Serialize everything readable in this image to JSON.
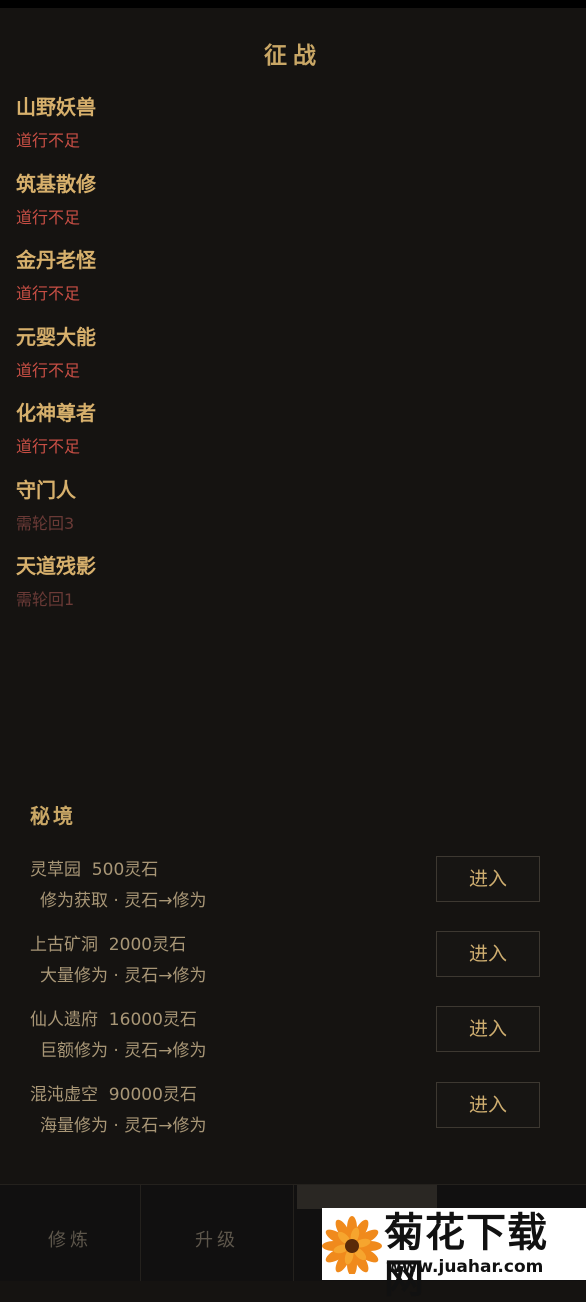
{
  "header": {
    "title": "征战"
  },
  "enemies": [
    {
      "name": "山野妖兽",
      "status": "道行不足"
    },
    {
      "name": "筑基散修",
      "status": "道行不足"
    },
    {
      "name": "金丹老怪",
      "status": "道行不足"
    },
    {
      "name": "元婴大能",
      "status": "道行不足"
    },
    {
      "name": "化神尊者",
      "status": "道行不足"
    },
    {
      "name": "守门人",
      "status": "需轮回3"
    },
    {
      "name": "天道残影",
      "status": "需轮回1"
    }
  ],
  "secret_realms": {
    "title": "秘境",
    "items": [
      {
        "name": "灵草园  500灵石",
        "desc": "修为获取 · 灵石→修为",
        "button": "进入"
      },
      {
        "name": "上古矿洞  2000灵石",
        "desc": "大量修为 · 灵石→修为",
        "button": "进入"
      },
      {
        "name": "仙人遗府  16000灵石",
        "desc": "巨额修为 · 灵石→修为",
        "button": "进入"
      },
      {
        "name": "混沌虚空  90000灵石",
        "desc": "海量修为 · 灵石→修为",
        "button": "进入"
      }
    ]
  },
  "nav": {
    "items": [
      {
        "label": "修炼"
      },
      {
        "label": "升级"
      }
    ]
  },
  "watermark": {
    "brand": "菊花下载网",
    "url": "www.juahar.com"
  },
  "colors": {
    "background": "#151311",
    "gold": "#d7b06c",
    "warning_red": "#c94f45",
    "locked": "#6a3a36"
  }
}
